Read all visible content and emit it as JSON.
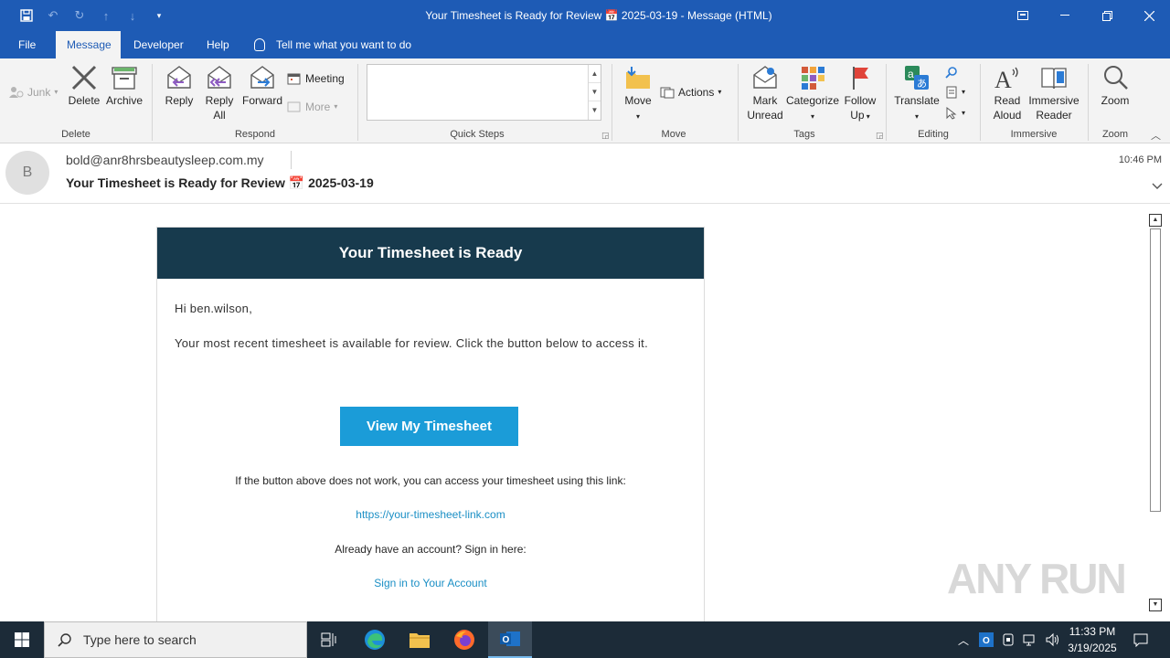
{
  "window": {
    "title": "Your Timesheet is Ready for Review 📅 2025-03-19  -  Message (HTML)"
  },
  "menu": {
    "tabs": [
      "File",
      "Message",
      "Developer",
      "Help"
    ],
    "tell_me": "Tell me what you want to do"
  },
  "ribbon": {
    "junk": "Junk",
    "delete": "Delete",
    "archive": "Archive",
    "reply": "Reply",
    "reply_all_1": "Reply",
    "reply_all_2": "All",
    "forward": "Forward",
    "meeting": "Meeting",
    "more": "More",
    "move": "Move",
    "actions": "Actions",
    "mark_unread_1": "Mark",
    "mark_unread_2": "Unread",
    "categorize": "Categorize",
    "follow_up_1": "Follow",
    "follow_up_2": "Up",
    "translate": "Translate",
    "read_aloud_1": "Read",
    "read_aloud_2": "Aloud",
    "immersive_reader_1": "Immersive",
    "immersive_reader_2": "Reader",
    "zoom": "Zoom",
    "groups": {
      "delete": "Delete",
      "respond": "Respond",
      "quick_steps": "Quick Steps",
      "move": "Move",
      "tags": "Tags",
      "editing": "Editing",
      "immersive": "Immersive",
      "zoom": "Zoom"
    }
  },
  "message": {
    "avatar_initial": "B",
    "from": "bold@anr8hrsbeautysleep.com.my",
    "subject": "Your Timesheet is Ready for Review 📅 2025-03-19",
    "time": "10:46 PM"
  },
  "email_body": {
    "header": "Your Timesheet is Ready",
    "greeting": "Hi ben.wilson,",
    "intro": "Your most recent timesheet is available for review. Click the button below to access it.",
    "button": "View My Timesheet",
    "fallback_text": "If the button above does not work, you can access your timesheet using this link:",
    "fallback_link": "https://your-timesheet-link.com",
    "signin_prompt": "Already have an account? Sign in here:",
    "signin_link": "Sign in to Your Account"
  },
  "watermark": "ANY RUN",
  "taskbar": {
    "search_placeholder": "Type here to search",
    "clock_time": "11:33 PM",
    "clock_date": "3/19/2025"
  },
  "colors": {
    "title_bar": "#1e5bb5",
    "email_header": "#173a4d",
    "cta_button": "#1b9cd8",
    "link": "#1b8fc5",
    "taskbar": "#1c2b38"
  }
}
